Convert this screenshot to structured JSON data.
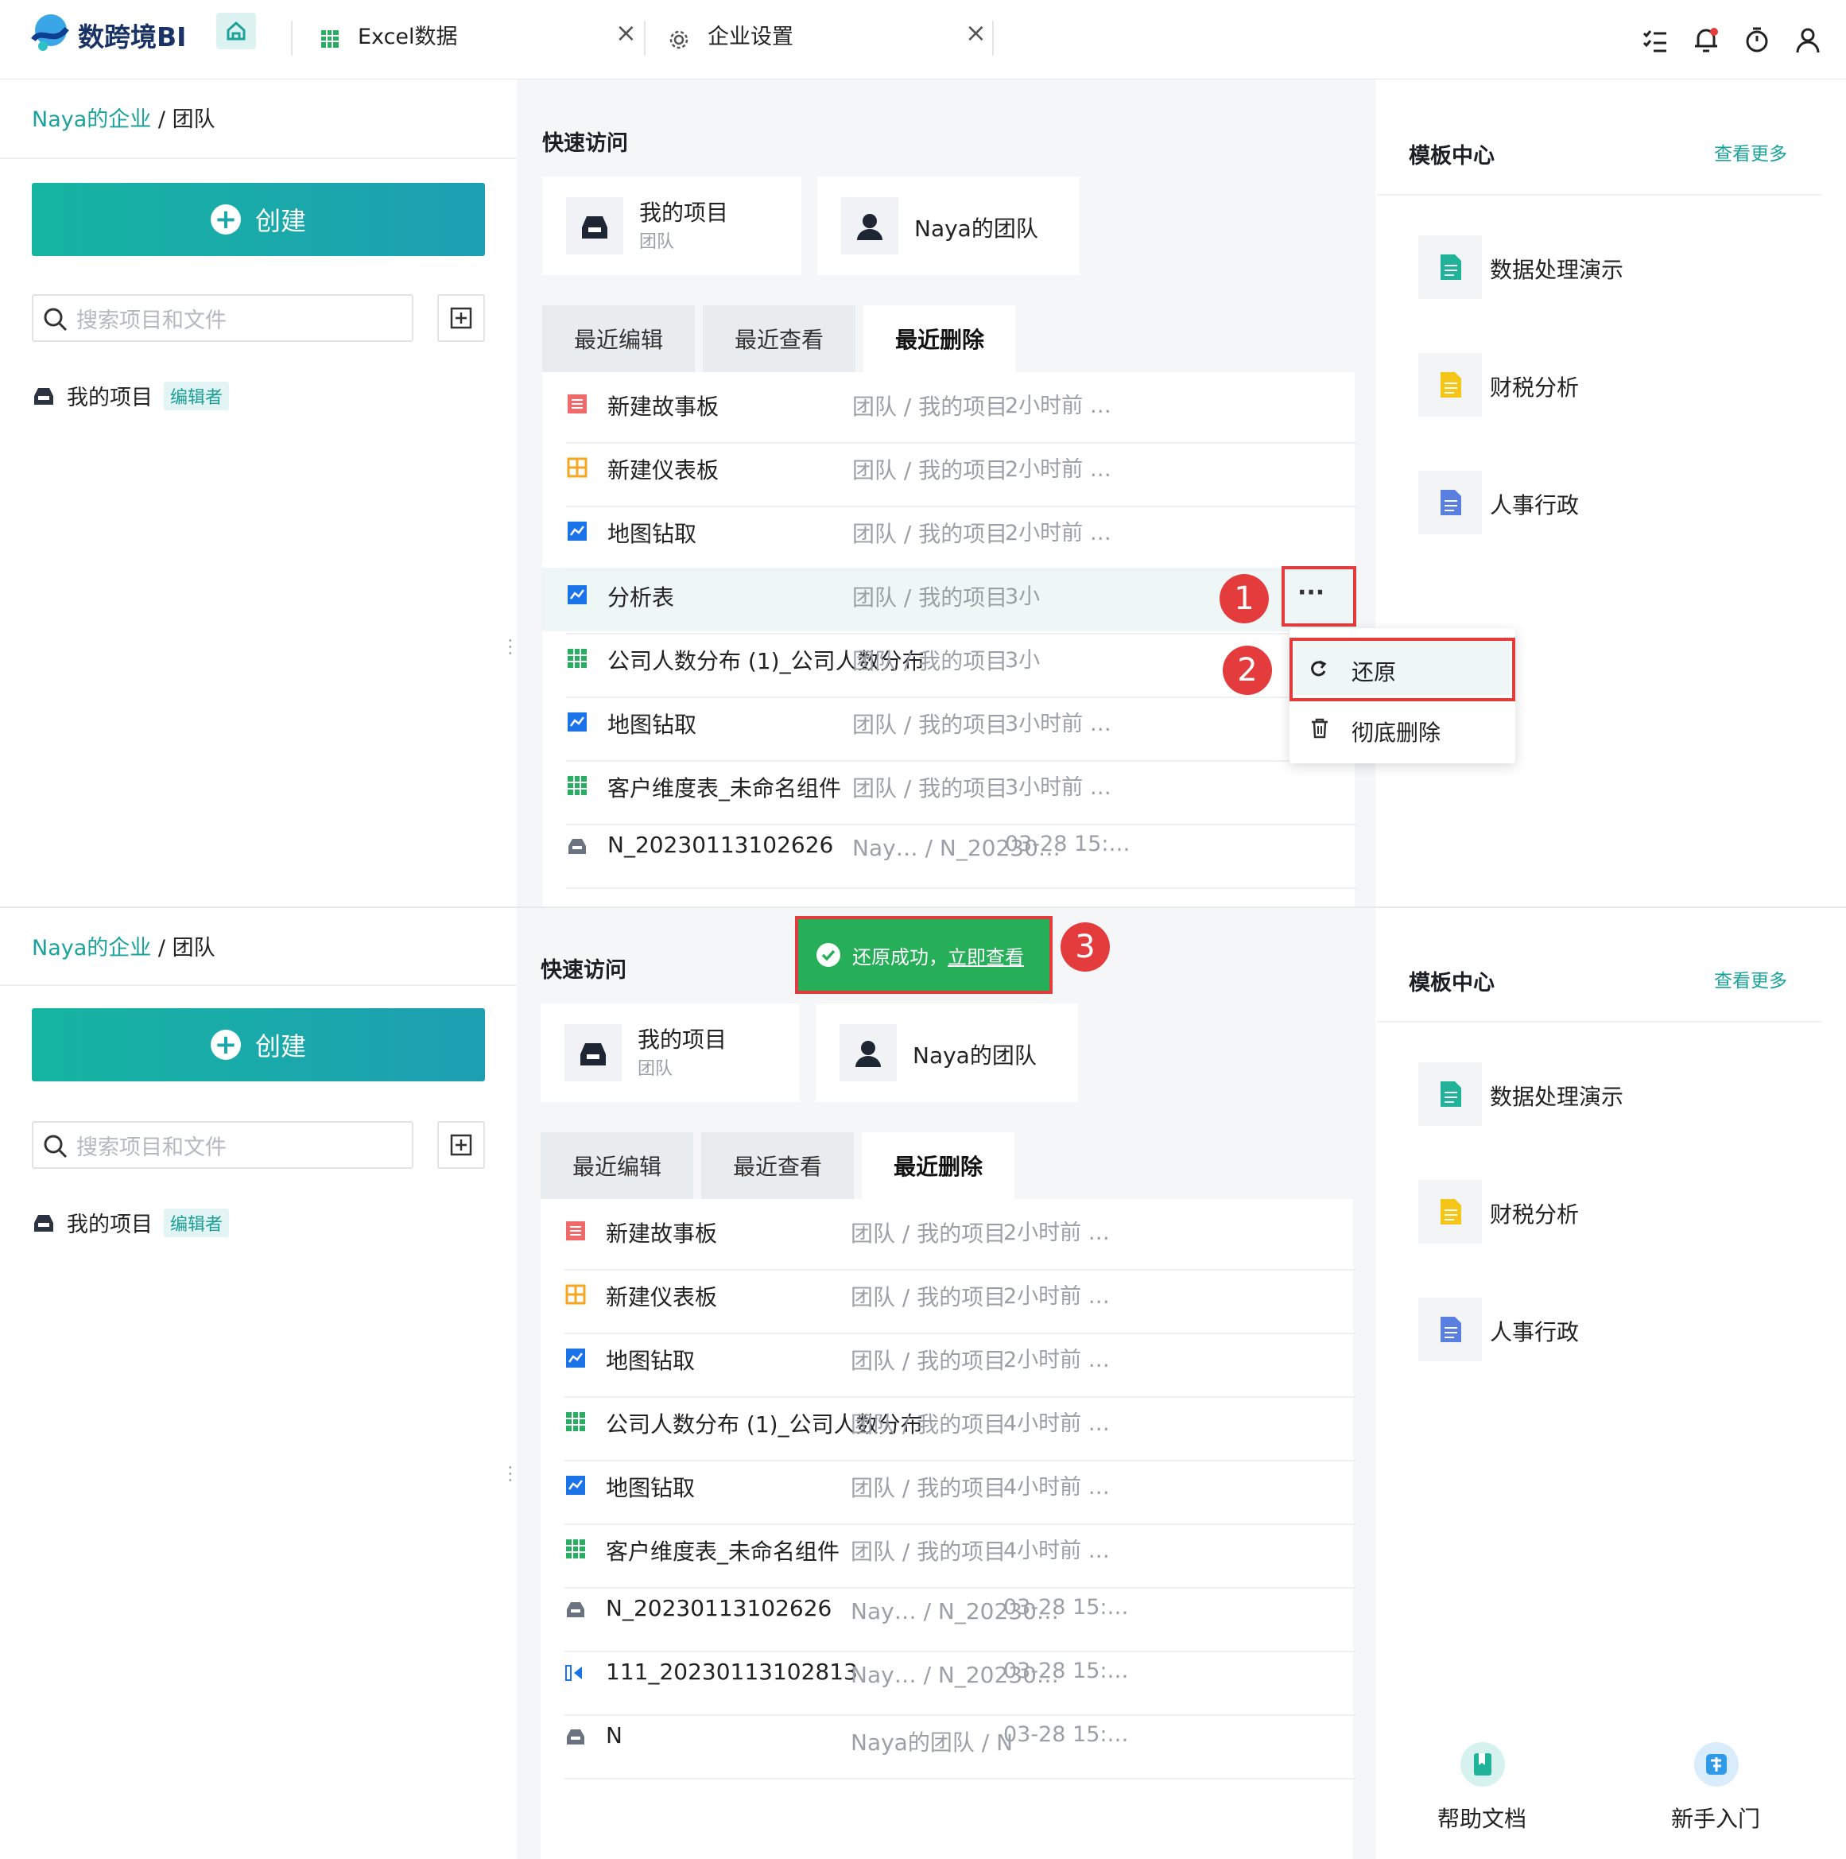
{
  "app": {
    "brand": "数跨境BI",
    "accent": "#1aa39a"
  },
  "tabs": [
    {
      "label": "Excel数据",
      "icon": "sheet-icon"
    },
    {
      "label": "企业设置",
      "icon": "gear-icon"
    }
  ],
  "toolbar": {
    "icons": [
      "task-list-icon",
      "bell-icon",
      "timer-icon",
      "user-icon"
    ]
  },
  "panels": [
    {
      "breadcrumb": {
        "org": "Naya的企业",
        "sep": "/",
        "current": "团队"
      },
      "create_label": "创建",
      "search_placeholder": "搜索项目和文件",
      "project": {
        "name": "我的项目",
        "badge": "编辑者"
      },
      "quick": {
        "title": "快速访问",
        "cards": [
          {
            "name": "我的项目",
            "sub": "团队"
          },
          {
            "name": "Naya的团队"
          }
        ]
      },
      "recent_tabs": [
        "最近编辑",
        "最近查看",
        "最近删除"
      ],
      "rows": [
        {
          "name": "新建故事板",
          "path": "团队 / 我的项目",
          "time": "2小时前 …",
          "icon": "story-icon"
        },
        {
          "name": "新建仪表板",
          "path": "团队 / 我的项目",
          "time": "2小时前 …",
          "icon": "dashboard-icon"
        },
        {
          "name": "地图钻取",
          "path": "团队 / 我的项目",
          "time": "2小时前 …",
          "icon": "chart-icon"
        },
        {
          "name": "分析表",
          "path": "团队 / 我的项目",
          "time": "3小",
          "icon": "chart-icon"
        },
        {
          "name": "公司人数分布 (1)_公司人数分布",
          "path": "团队 / 我的项目",
          "time": "3小",
          "icon": "table-icon"
        },
        {
          "name": "地图钻取",
          "path": "团队 / 我的项目",
          "time": "3小时前 …",
          "icon": "chart-icon"
        },
        {
          "name": "客户维度表_未命名组件",
          "path": "团队 / 我的项目",
          "time": "3小时前 …",
          "icon": "table-icon"
        },
        {
          "name": "N_20230113102626",
          "path": "Nay…  / N_20230…",
          "time": "03-28 15:…",
          "icon": "inbox-icon"
        }
      ],
      "template": {
        "title": "模板中心",
        "more": "查看更多",
        "items": [
          "数据处理演示",
          "财税分析",
          "人事行政"
        ]
      }
    },
    {
      "breadcrumb": {
        "org": "Naya的企业",
        "sep": "/",
        "current": "团队"
      },
      "create_label": "创建",
      "search_placeholder": "搜索项目和文件",
      "project": {
        "name": "我的项目",
        "badge": "编辑者"
      },
      "quick": {
        "title": "快速访问",
        "cards": [
          {
            "name": "我的项目",
            "sub": "团队"
          },
          {
            "name": "Naya的团队"
          }
        ]
      },
      "recent_tabs": [
        "最近编辑",
        "最近查看",
        "最近删除"
      ],
      "rows": [
        {
          "name": "新建故事板",
          "path": "团队 / 我的项目",
          "time": "2小时前 …",
          "icon": "story-icon"
        },
        {
          "name": "新建仪表板",
          "path": "团队 / 我的项目",
          "time": "2小时前 …",
          "icon": "dashboard-icon"
        },
        {
          "name": "地图钻取",
          "path": "团队 / 我的项目",
          "time": "2小时前 …",
          "icon": "chart-icon"
        },
        {
          "name": "公司人数分布 (1)_公司人数分布",
          "path": "团队 / 我的项目",
          "time": "4小时前 …",
          "icon": "table-icon"
        },
        {
          "name": "地图钻取",
          "path": "团队 / 我的项目",
          "time": "4小时前 …",
          "icon": "chart-icon"
        },
        {
          "name": "客户维度表_未命名组件",
          "path": "团队 / 我的项目",
          "time": "4小时前 …",
          "icon": "table-icon"
        },
        {
          "name": "N_20230113102626",
          "path": "Nay…  / N_20230…",
          "time": "03-28 15:…",
          "icon": "inbox-icon"
        },
        {
          "name": "111_20230113102813",
          "path": "Nay…  / N_20230…",
          "time": "03-28 15:…",
          "icon": "dataset-icon"
        },
        {
          "name": "N",
          "path": "Naya的团队 / N",
          "time": "03-28 15:…",
          "icon": "inbox-icon"
        }
      ],
      "template": {
        "title": "模板中心",
        "more": "查看更多",
        "items": [
          "数据处理演示",
          "财税分析",
          "人事行政"
        ]
      },
      "help": [
        {
          "label": "帮助文档"
        },
        {
          "label": "新手入门"
        }
      ]
    }
  ],
  "context_menu": {
    "items": [
      {
        "label": "还原",
        "icon": "restore-icon"
      },
      {
        "label": "彻底删除",
        "icon": "trash-icon"
      }
    ]
  },
  "more_button": "···",
  "toast": {
    "text": "还原成功，",
    "link": "立即查看"
  },
  "step_markers": [
    "1",
    "2",
    "3"
  ]
}
